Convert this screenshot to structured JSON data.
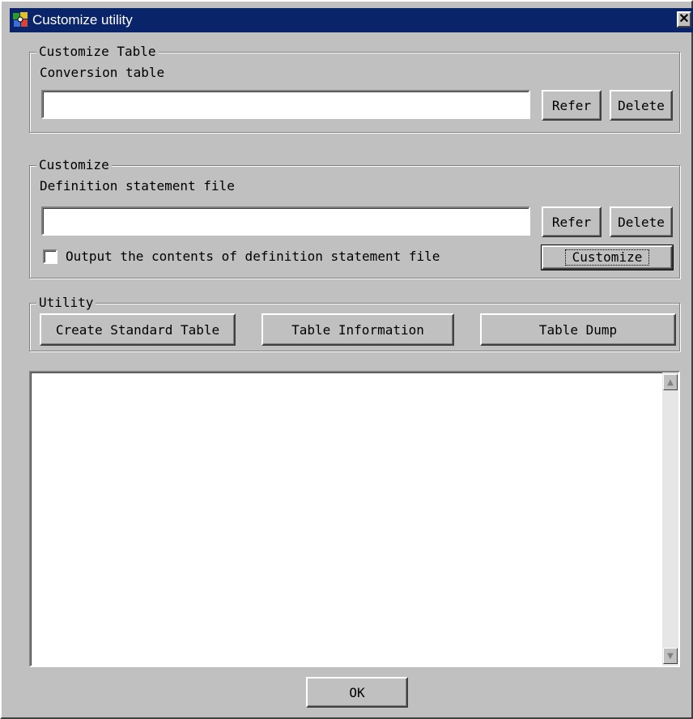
{
  "window": {
    "title": "Customize utility",
    "close_glyph": "✕",
    "app_icon": "customize-utility-icon"
  },
  "customize_table": {
    "legend": "Customize Table",
    "field_label": "Conversion table",
    "field_value": "",
    "refer_label": "Refer",
    "delete_label": "Delete"
  },
  "customize": {
    "legend": "Customize",
    "field_label": "Definition statement file",
    "field_value": "",
    "refer_label": "Refer",
    "delete_label": "Delete",
    "checkbox_label": "Output the contents of definition statement file",
    "checkbox_checked": false,
    "customize_label": "Customize"
  },
  "utility": {
    "legend": "Utility",
    "create_label": "Create Standard Table",
    "info_label": "Table Information",
    "dump_label": "Table Dump"
  },
  "output": {
    "text": "",
    "scroll_up_glyph": "▲",
    "scroll_down_glyph": "▼"
  },
  "footer": {
    "ok_label": "OK"
  },
  "colors": {
    "titlebar": "#0a246a",
    "face": "#c0c0c0"
  }
}
